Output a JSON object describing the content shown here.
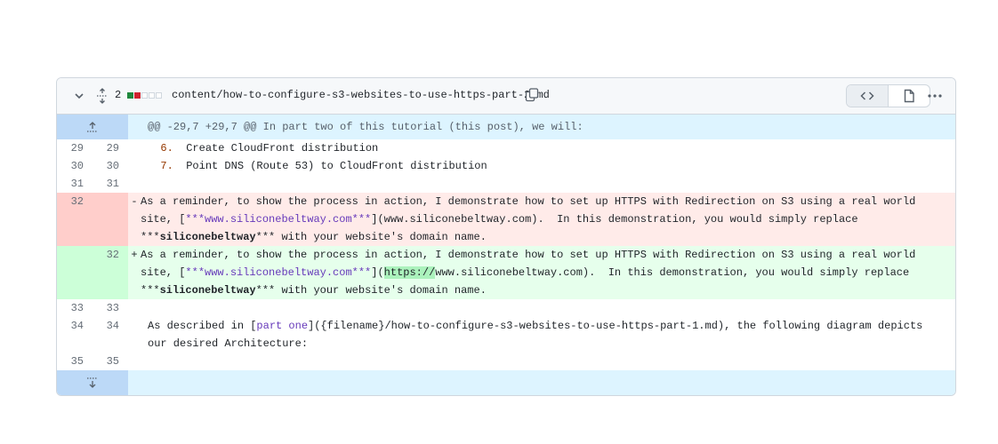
{
  "header": {
    "changes_count": "2",
    "file_path": "content/how-to-configure-s3-websites-to-use-https-part-2.md",
    "stat": [
      "add",
      "del",
      "neu",
      "neu",
      "neu"
    ]
  },
  "hunk": {
    "header": "@@ -29,7 +29,7 @@ In part two of this tutorial (this post), we will:"
  },
  "lines": {
    "l29": {
      "old": "29",
      "new": "29",
      "marker": "6.",
      "text": "Create CloudFront distribution"
    },
    "l30": {
      "old": "30",
      "new": "30",
      "marker": "7.",
      "text": "Point DNS (Route 53) to CloudFront distribution"
    },
    "l31": {
      "old": "31",
      "new": "31"
    },
    "del": {
      "old": "32",
      "sign": "-",
      "p1": "As a reminder, to show the process in action, I demonstrate how to set up HTTPS with Redirection on S3 using a real world site, ",
      "p2": "[",
      "link": "***www.siliconebeltway.com***",
      "p3": "](www.siliconebeltway.com).  In this demonstration, you would simply replace ",
      "bold_prefix": "***",
      "bold": "siliconebeltway",
      "bold_suffix": "***",
      "p4": " with your website's domain name."
    },
    "add": {
      "new": "32",
      "sign": "+",
      "p1": "As a reminder, to show the process in action, I demonstrate how to set up HTTPS with Redirection on S3 using a real world site, ",
      "p2": "[",
      "link": "***www.siliconebeltway.com***",
      "p3a": "](",
      "highlight": "https://",
      "p3b": "www.siliconebeltway.com).  In this demonstration, you would simply replace ",
      "bold_prefix": "***",
      "bold": "siliconebeltway",
      "bold_suffix": "***",
      "p4": " with your website's domain name."
    },
    "l33": {
      "old": "33",
      "new": "33"
    },
    "l34": {
      "old": "34",
      "new": "34",
      "p1": "As described in [",
      "link": "part one",
      "p2": "]({filename}/how-to-configure-s3-websites-to-use-https-part-1.md), the following diagram depicts our desired Architecture:"
    },
    "l35": {
      "old": "35",
      "new": "35"
    }
  }
}
